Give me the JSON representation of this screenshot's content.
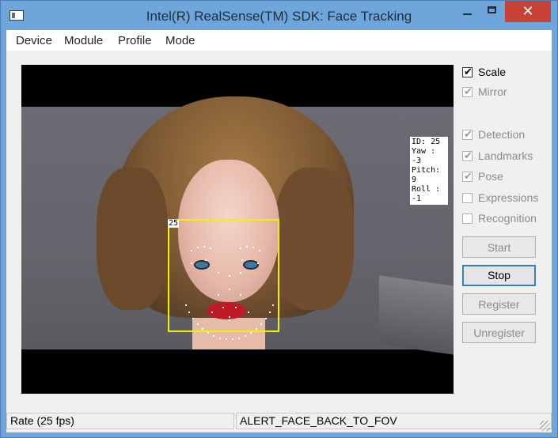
{
  "window": {
    "title": "Intel(R) RealSense(TM) SDK: Face Tracking",
    "minimize_label": "",
    "maximize_label": "",
    "close_label": "✕"
  },
  "menu": [
    "Device",
    "Module",
    "Profile",
    "Mode"
  ],
  "overlay": {
    "face_tag": "25",
    "info_lines": [
      "ID: 25",
      "Yaw : -3",
      "Pitch: 9",
      "Roll : -1"
    ]
  },
  "checkboxes": {
    "scale": {
      "label": "Scale",
      "checked": true,
      "enabled": true
    },
    "mirror": {
      "label": "Mirror",
      "checked": true,
      "enabled": false
    },
    "detection": {
      "label": "Detection",
      "checked": true,
      "enabled": false
    },
    "landmarks": {
      "label": "Landmarks",
      "checked": true,
      "enabled": false
    },
    "pose": {
      "label": "Pose",
      "checked": true,
      "enabled": false
    },
    "expressions": {
      "label": "Expressions",
      "checked": false,
      "enabled": false
    },
    "recognition": {
      "label": "Recognition",
      "checked": false,
      "enabled": false
    }
  },
  "buttons": {
    "start": "Start",
    "stop": "Stop",
    "register": "Register",
    "unregister": "Unregister"
  },
  "status": {
    "rate": "Rate (25 fps)",
    "alert": "ALERT_FACE_BACK_TO_FOV"
  },
  "colors": {
    "titlebar": "#6ea6db",
    "close": "#c84235",
    "face_box": "#f5f000"
  }
}
